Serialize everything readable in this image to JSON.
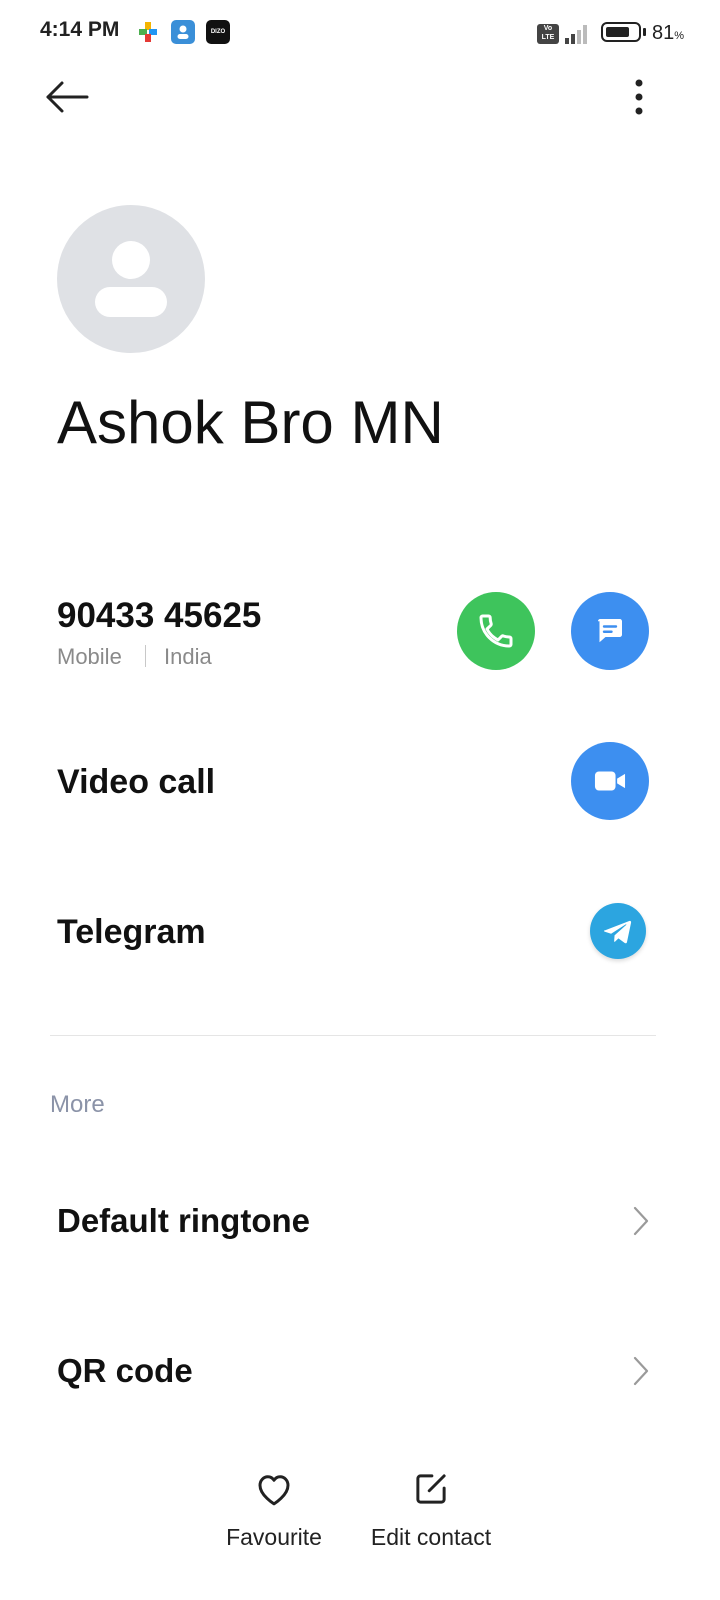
{
  "status_bar": {
    "time": "4:14 PM",
    "notification_icons": [
      "puzzle-app-icon",
      "contacts-app-icon",
      "dizo-app-icon"
    ],
    "dizo_label": "DIZO",
    "volte_label": "Vo LTE",
    "battery_percent": "81",
    "battery_unit": "%",
    "battery_level": 0.81
  },
  "toolbar": {
    "back_icon": "arrow-left-icon",
    "more_icon": "more-vertical-icon"
  },
  "contact": {
    "name": "Ashok Bro MN",
    "avatar_icon": "person-placeholder-icon"
  },
  "phone": {
    "number": "90433 45625",
    "type": "Mobile",
    "region": "India",
    "call_icon": "phone-icon",
    "message_icon": "message-icon",
    "call_color": "#3ec45c",
    "message_color": "#3d8ff0"
  },
  "video_call": {
    "label": "Video call",
    "icon": "video-camera-icon"
  },
  "telegram": {
    "label": "Telegram",
    "icon": "telegram-icon",
    "color": "#2ca5e0"
  },
  "more_section": {
    "title": "More",
    "items": [
      {
        "label": "Default ringtone",
        "icon": "chevron-right-icon"
      },
      {
        "label": "QR code",
        "icon": "chevron-right-icon"
      }
    ]
  },
  "bottom_bar": {
    "favourite_label": "Favourite",
    "favourite_icon": "heart-outline-icon",
    "edit_label": "Edit contact",
    "edit_icon": "edit-square-icon"
  }
}
